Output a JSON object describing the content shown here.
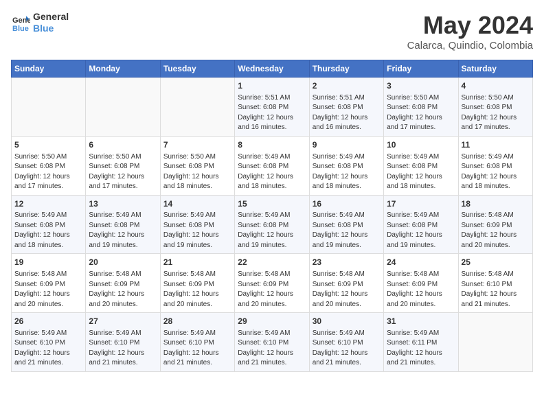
{
  "logo": {
    "line1": "General",
    "line2": "Blue"
  },
  "title": "May 2024",
  "subtitle": "Calarca, Quindio, Colombia",
  "days_of_week": [
    "Sunday",
    "Monday",
    "Tuesday",
    "Wednesday",
    "Thursday",
    "Friday",
    "Saturday"
  ],
  "weeks": [
    [
      {
        "day": "",
        "info": ""
      },
      {
        "day": "",
        "info": ""
      },
      {
        "day": "",
        "info": ""
      },
      {
        "day": "1",
        "info": "Sunrise: 5:51 AM\nSunset: 6:08 PM\nDaylight: 12 hours and 16 minutes."
      },
      {
        "day": "2",
        "info": "Sunrise: 5:51 AM\nSunset: 6:08 PM\nDaylight: 12 hours and 16 minutes."
      },
      {
        "day": "3",
        "info": "Sunrise: 5:50 AM\nSunset: 6:08 PM\nDaylight: 12 hours and 17 minutes."
      },
      {
        "day": "4",
        "info": "Sunrise: 5:50 AM\nSunset: 6:08 PM\nDaylight: 12 hours and 17 minutes."
      }
    ],
    [
      {
        "day": "5",
        "info": "Sunrise: 5:50 AM\nSunset: 6:08 PM\nDaylight: 12 hours and 17 minutes."
      },
      {
        "day": "6",
        "info": "Sunrise: 5:50 AM\nSunset: 6:08 PM\nDaylight: 12 hours and 17 minutes."
      },
      {
        "day": "7",
        "info": "Sunrise: 5:50 AM\nSunset: 6:08 PM\nDaylight: 12 hours and 18 minutes."
      },
      {
        "day": "8",
        "info": "Sunrise: 5:49 AM\nSunset: 6:08 PM\nDaylight: 12 hours and 18 minutes."
      },
      {
        "day": "9",
        "info": "Sunrise: 5:49 AM\nSunset: 6:08 PM\nDaylight: 12 hours and 18 minutes."
      },
      {
        "day": "10",
        "info": "Sunrise: 5:49 AM\nSunset: 6:08 PM\nDaylight: 12 hours and 18 minutes."
      },
      {
        "day": "11",
        "info": "Sunrise: 5:49 AM\nSunset: 6:08 PM\nDaylight: 12 hours and 18 minutes."
      }
    ],
    [
      {
        "day": "12",
        "info": "Sunrise: 5:49 AM\nSunset: 6:08 PM\nDaylight: 12 hours and 18 minutes."
      },
      {
        "day": "13",
        "info": "Sunrise: 5:49 AM\nSunset: 6:08 PM\nDaylight: 12 hours and 19 minutes."
      },
      {
        "day": "14",
        "info": "Sunrise: 5:49 AM\nSunset: 6:08 PM\nDaylight: 12 hours and 19 minutes."
      },
      {
        "day": "15",
        "info": "Sunrise: 5:49 AM\nSunset: 6:08 PM\nDaylight: 12 hours and 19 minutes."
      },
      {
        "day": "16",
        "info": "Sunrise: 5:49 AM\nSunset: 6:08 PM\nDaylight: 12 hours and 19 minutes."
      },
      {
        "day": "17",
        "info": "Sunrise: 5:49 AM\nSunset: 6:08 PM\nDaylight: 12 hours and 19 minutes."
      },
      {
        "day": "18",
        "info": "Sunrise: 5:48 AM\nSunset: 6:09 PM\nDaylight: 12 hours and 20 minutes."
      }
    ],
    [
      {
        "day": "19",
        "info": "Sunrise: 5:48 AM\nSunset: 6:09 PM\nDaylight: 12 hours and 20 minutes."
      },
      {
        "day": "20",
        "info": "Sunrise: 5:48 AM\nSunset: 6:09 PM\nDaylight: 12 hours and 20 minutes."
      },
      {
        "day": "21",
        "info": "Sunrise: 5:48 AM\nSunset: 6:09 PM\nDaylight: 12 hours and 20 minutes."
      },
      {
        "day": "22",
        "info": "Sunrise: 5:48 AM\nSunset: 6:09 PM\nDaylight: 12 hours and 20 minutes."
      },
      {
        "day": "23",
        "info": "Sunrise: 5:48 AM\nSunset: 6:09 PM\nDaylight: 12 hours and 20 minutes."
      },
      {
        "day": "24",
        "info": "Sunrise: 5:48 AM\nSunset: 6:09 PM\nDaylight: 12 hours and 20 minutes."
      },
      {
        "day": "25",
        "info": "Sunrise: 5:48 AM\nSunset: 6:10 PM\nDaylight: 12 hours and 21 minutes."
      }
    ],
    [
      {
        "day": "26",
        "info": "Sunrise: 5:49 AM\nSunset: 6:10 PM\nDaylight: 12 hours and 21 minutes."
      },
      {
        "day": "27",
        "info": "Sunrise: 5:49 AM\nSunset: 6:10 PM\nDaylight: 12 hours and 21 minutes."
      },
      {
        "day": "28",
        "info": "Sunrise: 5:49 AM\nSunset: 6:10 PM\nDaylight: 12 hours and 21 minutes."
      },
      {
        "day": "29",
        "info": "Sunrise: 5:49 AM\nSunset: 6:10 PM\nDaylight: 12 hours and 21 minutes."
      },
      {
        "day": "30",
        "info": "Sunrise: 5:49 AM\nSunset: 6:10 PM\nDaylight: 12 hours and 21 minutes."
      },
      {
        "day": "31",
        "info": "Sunrise: 5:49 AM\nSunset: 6:11 PM\nDaylight: 12 hours and 21 minutes."
      },
      {
        "day": "",
        "info": ""
      }
    ]
  ]
}
